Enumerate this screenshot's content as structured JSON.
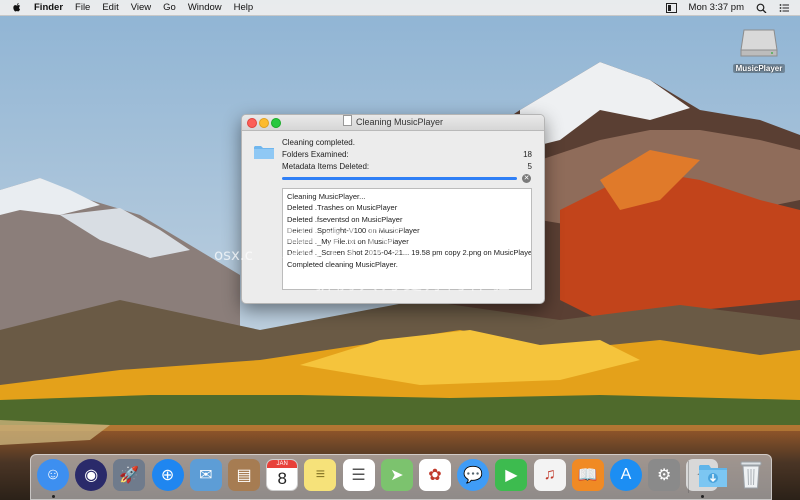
{
  "menubar": {
    "app_name": "Finder",
    "items": [
      "File",
      "Edit",
      "View",
      "Go",
      "Window",
      "Help"
    ],
    "clock": "Mon 3:37 pm"
  },
  "desktop": {
    "drive_label": "MusicPlayer"
  },
  "window": {
    "title": "Cleaning MusicPlayer",
    "status": "Cleaning completed.",
    "folders_label": "Folders Examined:",
    "folders_value": "18",
    "metadata_label": "Metadata Items Deleted:",
    "metadata_value": "5",
    "progress_fraction": 1.0,
    "log": [
      "Cleaning MusicPlayer...",
      "Deleted .Trashes on MusicPlayer",
      "Deleted .fseventsd on MusicPlayer",
      "Deleted .Spotlight-V100 on MusicPlayer",
      "Deleted ._My File.txt on MusicPlayer",
      "Deleted ._Screen Shot 2015-04-21... 19.58 pm copy 2.png on MusicPlayer",
      "Completed cleaning MusicPlayer."
    ]
  },
  "watermark": {
    "line1": "果社区",
    "line2": "折腾只为更好的体验",
    "line3": "osx.c"
  },
  "dock": {
    "apps": [
      {
        "name": "Finder",
        "icon": "finder-icon",
        "color": "#3d8ff0",
        "running": true
      },
      {
        "name": "Siri",
        "icon": "siri-icon",
        "color": "#2a2a6a",
        "running": false
      },
      {
        "name": "Launchpad",
        "icon": "launchpad-icon",
        "color": "#6f7b8c",
        "running": false
      },
      {
        "name": "Safari",
        "icon": "safari-icon",
        "color": "#1f86f0",
        "running": false
      },
      {
        "name": "Mail",
        "icon": "mail-icon",
        "color": "#5d9dd6",
        "running": false
      },
      {
        "name": "Contacts",
        "icon": "contacts-icon",
        "color": "#a67c52",
        "running": false
      },
      {
        "name": "Calendar",
        "icon": "calendar-icon",
        "color": "#ffffff",
        "running": false
      },
      {
        "name": "Notes",
        "icon": "notes-icon",
        "color": "#f6e27a",
        "running": false
      },
      {
        "name": "Reminders",
        "icon": "reminders-icon",
        "color": "#ffffff",
        "running": false
      },
      {
        "name": "Maps",
        "icon": "maps-icon",
        "color": "#7cc36e",
        "running": false
      },
      {
        "name": "Photos",
        "icon": "photos-icon",
        "color": "#ffffff",
        "running": false
      },
      {
        "name": "Messages",
        "icon": "messages-icon",
        "color": "#3f9cf6",
        "running": false
      },
      {
        "name": "FaceTime",
        "icon": "facetime-icon",
        "color": "#3dbb4f",
        "running": false
      },
      {
        "name": "iTunes",
        "icon": "itunes-icon",
        "color": "#f3f3f3",
        "running": false
      },
      {
        "name": "iBooks",
        "icon": "ibooks-icon",
        "color": "#f08a24",
        "running": false
      },
      {
        "name": "App Store",
        "icon": "appstore-icon",
        "color": "#1c8ef3",
        "running": false
      },
      {
        "name": "System Preferences",
        "icon": "system-preferences-icon",
        "color": "#8a8a8a",
        "running": false
      },
      {
        "name": "CleanMyDrive",
        "icon": "cleaner-app-icon",
        "color": "#d8d8d8",
        "running": true
      }
    ],
    "downloads": {
      "name": "Downloads",
      "icon": "downloads-folder-icon",
      "color": "#5fb5ea"
    },
    "trash": {
      "name": "Trash",
      "icon": "trash-icon",
      "color": "#e8eaec"
    },
    "calendar_month": "JAN",
    "calendar_day": "8"
  }
}
